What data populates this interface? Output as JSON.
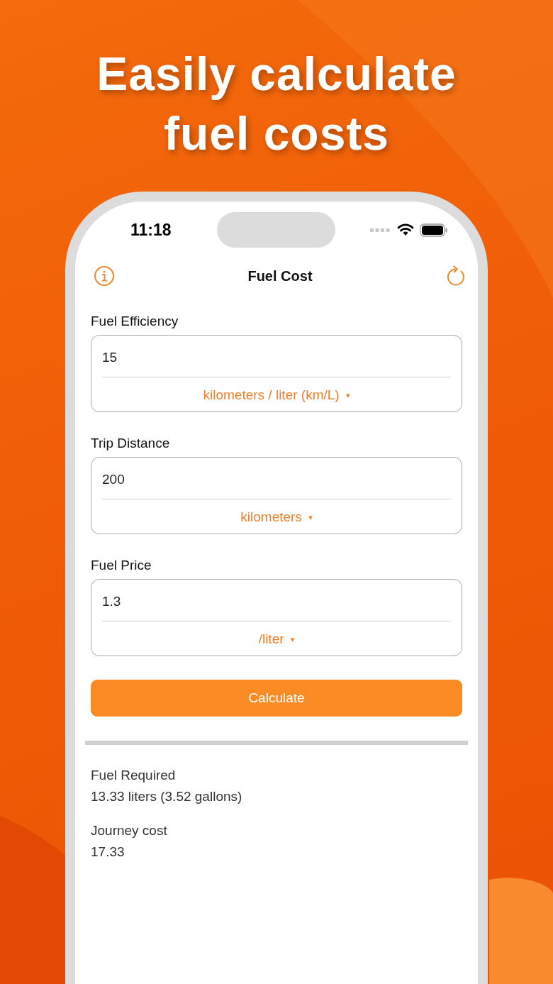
{
  "headline": [
    "Easily calculate",
    "fuel costs"
  ],
  "status_bar": {
    "time": "11:18"
  },
  "nav": {
    "title": "Fuel Cost"
  },
  "fields": [
    {
      "label": "Fuel Efficiency",
      "value": "15",
      "unit": "kilometers / liter (km/L)",
      "caret": "▾"
    },
    {
      "label": "Trip Distance",
      "value": "200",
      "unit": "kilometers",
      "caret": "▾"
    },
    {
      "label": "Fuel Price",
      "value": "1.3",
      "unit": "/liter",
      "caret": "▾"
    }
  ],
  "button": {
    "label": "Calculate"
  },
  "results": [
    {
      "label": "Fuel Required",
      "value": "13.33 liters (3.52 gallons)"
    },
    {
      "label": "Journey cost",
      "value": "17.33"
    }
  ]
}
